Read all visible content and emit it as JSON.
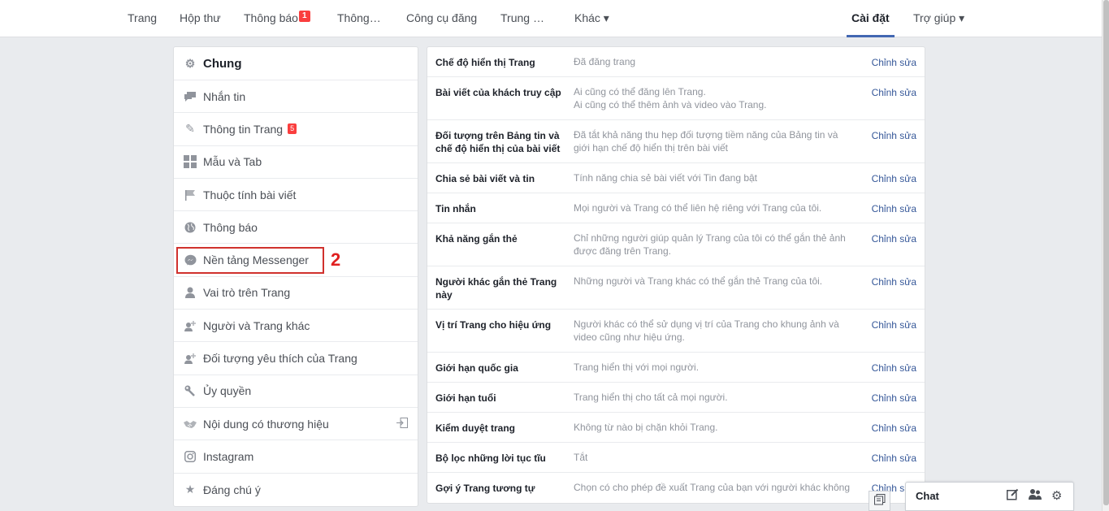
{
  "topnav": {
    "items": [
      {
        "label": "Trang"
      },
      {
        "label": "Hộp thư"
      },
      {
        "label": "Thông báo",
        "badge": "1"
      },
      {
        "label": "Thông…"
      },
      {
        "label": "Công cụ đăng"
      },
      {
        "label": "Trung …"
      },
      {
        "label": "Khác ▾"
      },
      {
        "label": "Cài đặt"
      },
      {
        "label": "Trợ giúp ▾"
      }
    ]
  },
  "leftmenu": {
    "items": [
      {
        "label": "Chung",
        "icon": "gear-icon"
      },
      {
        "label": "Nhắn tin",
        "icon": "messages-icon"
      },
      {
        "label": "Thông tin Trang",
        "icon": "pencil-icon",
        "badge": "5"
      },
      {
        "label": "Mẫu và Tab",
        "icon": "grid-icon"
      },
      {
        "label": "Thuộc tính bài viết",
        "icon": "flag-icon"
      },
      {
        "label": "Thông báo",
        "icon": "globe-icon"
      },
      {
        "label": "Nền tảng Messenger",
        "icon": "messenger-icon"
      },
      {
        "label": "Vai trò trên Trang",
        "icon": "person-icon"
      },
      {
        "label": "Người và Trang khác",
        "icon": "person-add-icon"
      },
      {
        "label": "Đối tượng yêu thích của Trang",
        "icon": "person-star-icon"
      },
      {
        "label": "Ủy quyền",
        "icon": "wrench-icon"
      },
      {
        "label": "Nội dung có thương hiệu",
        "icon": "handshake-icon"
      },
      {
        "label": "Instagram",
        "icon": "instagram-icon"
      },
      {
        "label": "Đáng chú ý",
        "icon": "star-icon"
      }
    ],
    "step_marker": "2"
  },
  "settings": {
    "edit_label": "Chỉnh sửa",
    "rows": [
      {
        "label": "Chế độ hiển thị Trang",
        "value": [
          "Đã đăng trang"
        ]
      },
      {
        "label": "Bài viết của khách truy cập",
        "value": [
          "Ai cũng có thể đăng lên Trang.",
          "Ai cũng có thể thêm ảnh và video vào Trang."
        ]
      },
      {
        "label": "Đối tượng trên Bảng tin và chế độ hiển thị của bài viết",
        "value": [
          "Đã tắt khả năng thu hẹp đối tượng tiềm năng của Bảng tin và",
          "giới hạn chế độ hiển thị trên bài viết"
        ]
      },
      {
        "label": "Chia sẻ bài viết và tin",
        "value": [
          "Tính năng chia sẻ bài viết với Tin đang bật"
        ]
      },
      {
        "label": "Tin nhắn",
        "value": [
          "Mọi người và Trang có thể liên hệ riêng với Trang của tôi."
        ]
      },
      {
        "label": "Khả năng gắn thẻ",
        "value": [
          "Chỉ những người giúp quản lý Trang của tôi có thể gắn thẻ ảnh",
          "được đăng trên Trang."
        ]
      },
      {
        "label": "Người khác gắn thẻ Trang này",
        "value": [
          "Những người và Trang khác có thể gắn thẻ Trang của tôi."
        ]
      },
      {
        "label": "Vị trí Trang cho hiệu ứng",
        "value": [
          "Người khác có thể sử dụng vị trí của Trang cho khung ảnh và",
          "video cũng như hiệu ứng."
        ]
      },
      {
        "label": "Giới hạn quốc gia",
        "value": [
          "Trang hiển thị với mọi người."
        ]
      },
      {
        "label": "Giới hạn tuổi",
        "value": [
          "Trang hiển thị cho tất cả mọi người."
        ]
      },
      {
        "label": "Kiểm duyệt trang",
        "value": [
          "Không từ nào bị chặn khỏi Trang."
        ]
      },
      {
        "label": "Bộ lọc những lời tục tĩu",
        "value": [
          "Tắt"
        ]
      },
      {
        "label": "Gợi ý Trang tương tự",
        "value": [
          "Chọn có cho phép đề xuất Trang của bạn với người khác không"
        ]
      }
    ]
  },
  "chat": {
    "label": "Chat"
  },
  "colors": {
    "accent": "#4267b2",
    "link": "#365899",
    "badge": "#fa3e3e",
    "highlight": "#d0312d"
  }
}
